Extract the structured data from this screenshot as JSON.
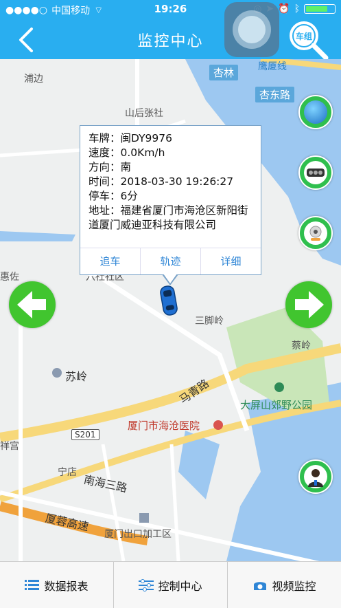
{
  "status_bar": {
    "carrier": "中国移动",
    "time": "19:26"
  },
  "nav": {
    "title": "监控中心",
    "search_car_label": "车组"
  },
  "map": {
    "labels": {
      "pudian": "浦边",
      "xinglin": "杏林",
      "yingsha": "鹰厦线",
      "xingdonglu": "杏东路",
      "shanhouzhang": "山后张社",
      "huizuo": "惠佐",
      "liushe": "六社社区",
      "sanjiaoling": "三脚岭",
      "cailing": "蔡岭",
      "suling": "苏岭",
      "maqinglu": "马青路",
      "dapingshan": "大屏山郊野公园",
      "hospital": "厦门市海沧医院",
      "s201": "S201",
      "xiangong": "祥宫",
      "ningdian": "宁店",
      "nanhai3": "南海三路",
      "xiarong": "厦蓉高速",
      "export_zone": "厦门出口加工区"
    }
  },
  "popup": {
    "plate": "车牌：闽DY9976",
    "speed": "速度：0.0Km/h",
    "direction": "方向：南",
    "time": "时间：2018-03-30 19:26:27",
    "parked": "停车：6分",
    "address": "地址：福建省厦门市海沧区新阳街道厦门威迪亚科技有限公司",
    "actions": {
      "follow": "追车",
      "track": "轨迹",
      "detail": "详细"
    }
  },
  "bottom_tabs": {
    "report": "数据报表",
    "control": "控制中心",
    "video": "视频监控"
  },
  "colors": {
    "header": "#29aef0",
    "button_green": "#2fbf4e",
    "link_blue": "#2f86d6",
    "water": "#9dc8f1",
    "road_yellow": "#f7d87a",
    "highway_orange": "#f0a23c"
  }
}
